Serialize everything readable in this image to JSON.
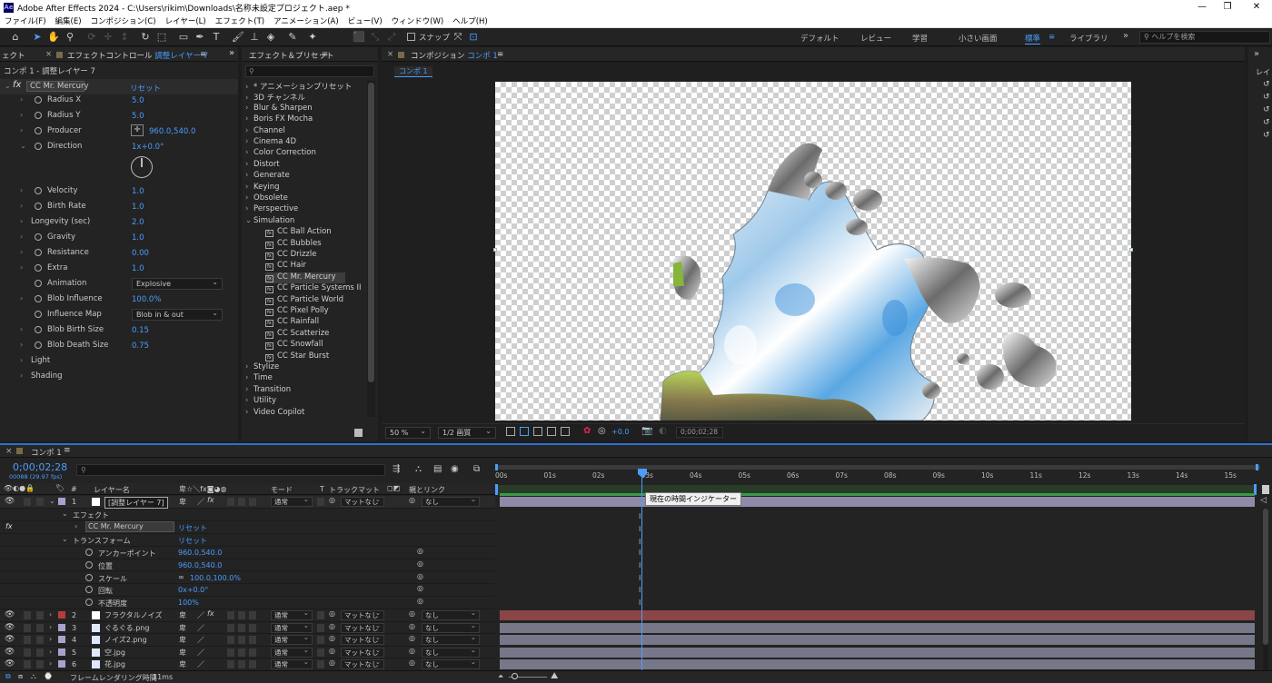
{
  "app": {
    "logo": "Ae",
    "title": "Adobe After Effects 2024 - C:\\Users\\rikim\\Downloads\\名称未設定プロジェクト.aep *"
  },
  "menu": [
    "ファイル(F)",
    "編集(E)",
    "コンポジション(C)",
    "レイヤー(L)",
    "エフェクト(T)",
    "アニメーション(A)",
    "ビュー(V)",
    "ウィンドウ(W)",
    "ヘルプ(H)"
  ],
  "toolbar": {
    "snap_label": "スナップ",
    "workspaces": [
      "デフォルト",
      "レビュー",
      "学習",
      "小さい画面",
      "標準",
      "ライブラリ"
    ],
    "active_workspace": "標準",
    "help_placeholder": "ヘルプを検索"
  },
  "effect_controls": {
    "left_tab": "ェクト",
    "tab_prefix": "エフェクトコントロール",
    "tab_layer": "調整レイヤー 7",
    "breadcrumb": "コンポ 1 - 調整レイヤー 7",
    "effect_name": "CC Mr. Mercury",
    "reset": "リセット",
    "params": [
      {
        "label": "Radius X",
        "value": "5.0"
      },
      {
        "label": "Radius Y",
        "value": "5.0"
      },
      {
        "label": "Producer",
        "value": "960.0,540.0"
      },
      {
        "label": "Direction",
        "value": "1x+0.0°"
      },
      {
        "label": "Velocity",
        "value": "1.0"
      },
      {
        "label": "Birth Rate",
        "value": "1.0"
      },
      {
        "label": "Longevity (sec)",
        "value": "2.0"
      },
      {
        "label": "Gravity",
        "value": "1.0"
      },
      {
        "label": "Resistance",
        "value": "0.00"
      },
      {
        "label": "Extra",
        "value": "1.0"
      },
      {
        "label": "Animation",
        "value": "Explosive"
      },
      {
        "label": "Blob Influence",
        "value": "100.0%"
      },
      {
        "label": "Influence Map",
        "value": "Blob in & out"
      },
      {
        "label": "Blob Birth Size",
        "value": "0.15"
      },
      {
        "label": "Blob Death Size",
        "value": "0.75"
      },
      {
        "label": "Light",
        "value": ""
      },
      {
        "label": "Shading",
        "value": ""
      }
    ]
  },
  "effects_presets": {
    "tab": "エフェクト＆プリセット",
    "search_placeholder": "",
    "categories_top": [
      "* アニメーションプリセット",
      "3D チャンネル",
      "Blur & Sharpen",
      "Boris FX Mocha",
      "Channel",
      "Cinema 4D",
      "Color Correction",
      "Distort",
      "Generate",
      "Keying",
      "Obsolete",
      "Perspective",
      "Simulation"
    ],
    "simulation_items": [
      "CC Ball Action",
      "CC Bubbles",
      "CC Drizzle",
      "CC Hair",
      "CC Mr. Mercury",
      "CC Particle Systems II",
      "CC Particle World",
      "CC Pixel Polly",
      "CC Rainfall",
      "CC Scatterize",
      "CC Snowfall",
      "CC Star Burst"
    ],
    "selected": "CC Mr. Mercury",
    "categories_bottom": [
      "Stylize",
      "Time",
      "Transition",
      "Utility",
      "Video Copilot",
      "イマーシブビデオ"
    ]
  },
  "composition": {
    "tab_prefix": "コンポジション",
    "tab_name": "コンポ 1",
    "sub_tab": "コンポ 1",
    "zoom": "50 %",
    "resolution": "1/2 画質",
    "exposure": "+0.0",
    "timecode": "0;00;02;28"
  },
  "timeline": {
    "tab": "コンポ 1",
    "timecode": "0;00;02;28",
    "frame_info": "00088 (29.97 fps)",
    "headers": {
      "layer_name": "レイヤー名",
      "mode": "モード",
      "track_matte": "トラックマット",
      "parent": "親とリンク"
    },
    "ruler": [
      "00s",
      "01s",
      "02s",
      "03s",
      "04s",
      "05s",
      "06s",
      "07s",
      "08s",
      "09s",
      "10s",
      "11s",
      "12s",
      "13s",
      "14s",
      "15s"
    ],
    "tooltip": "現在の時間インジケーター",
    "layers": [
      {
        "num": "1",
        "name": "[調整レイヤー 7]",
        "mode": "通常",
        "matte": "マットなし",
        "parent": "なし",
        "color": "#a9a2cc",
        "bar": "#8f8aa8"
      },
      {
        "num": "2",
        "name": "フラクタルノイズ",
        "mode": "通常",
        "matte": "マットなし",
        "parent": "なし",
        "color": "#b93b3b",
        "bar": "#8a4646"
      },
      {
        "num": "3",
        "name": "ぐるぐる.png",
        "mode": "通常",
        "matte": "マットなし",
        "parent": "なし",
        "color": "#a9a2cc",
        "bar": "#77778a"
      },
      {
        "num": "4",
        "name": "ノイズ2.png",
        "mode": "通常",
        "matte": "マットなし",
        "parent": "なし",
        "color": "#a9a2cc",
        "bar": "#77778a"
      },
      {
        "num": "5",
        "name": "空.jpg",
        "mode": "通常",
        "matte": "マットなし",
        "parent": "なし",
        "color": "#a9a2cc",
        "bar": "#77778a"
      },
      {
        "num": "6",
        "name": "花.jpg",
        "mode": "通常",
        "matte": "マットなし",
        "parent": "なし",
        "color": "#a9a2cc",
        "bar": "#77778a"
      }
    ],
    "sub": {
      "effects_group": "エフェクト",
      "effect_name": "CC Mr. Mercury",
      "reset": "リセット",
      "transform_group": "トランスフォーム",
      "transform_props": [
        {
          "label": "アンカーポイント",
          "value": "960.0,540.0"
        },
        {
          "label": "位置",
          "value": "960.0,540.0"
        },
        {
          "label": "スケール",
          "value": "100.0,100.0%"
        },
        {
          "label": "回転",
          "value": "0x+0.0°"
        },
        {
          "label": "不透明度",
          "value": "100%"
        }
      ]
    },
    "render_time_label": "フレームレンダリング時間",
    "render_time_value": "11ms"
  }
}
